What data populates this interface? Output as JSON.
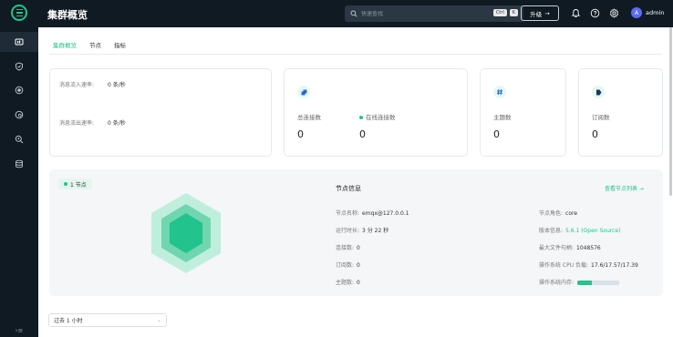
{
  "header": {
    "title": "集群概览",
    "search_placeholder": "快速查找",
    "kbd_ctrl": "Ctrl",
    "kbd_k": "K",
    "upgrade": "升级",
    "user": "admin",
    "avatar_letter": "A"
  },
  "tabs": [
    "集群概览",
    "节点",
    "指标"
  ],
  "rates": {
    "in_label": "消息流入速率:",
    "in_value": "0 条/秒",
    "out_label": "消息流出速率:",
    "out_value": "0 条/秒"
  },
  "stats": {
    "connections_label": "总连接数",
    "connections_value": "0",
    "online_label": "在线连接数",
    "online_value": "0",
    "topics_label": "主题数",
    "topics_value": "0",
    "subs_label": "订阅数",
    "subs_value": "0"
  },
  "node": {
    "badge": "1 节点",
    "info_title": "节点信息",
    "view_list": "查看节点列表 →",
    "name_label": "节点名称:",
    "name": "emqx@127.0.0.1",
    "uptime_label": "运行时长:",
    "uptime": "3 分 22 秒",
    "conn_label": "连接数:",
    "conn": "0",
    "sub_label": "订阅数:",
    "sub": "0",
    "topic_label": "主题数:",
    "topic": "0",
    "role_label": "节点角色:",
    "role": "core",
    "version_label": "版本信息:",
    "version": "5.6.1 (Open Source)",
    "maxfd_label": "最大文件句柄:",
    "maxfd": "1048576",
    "cpu_label": "操作系统 CPU 负载:",
    "cpu": "17.6/17.57/17.39",
    "mem_label": "操作系统内存:",
    "mem_fraction": 0.35
  },
  "time_range": "过去 1 小时",
  "colors": {
    "accent": "#22c38d",
    "sidebar": "#0f1a23"
  }
}
